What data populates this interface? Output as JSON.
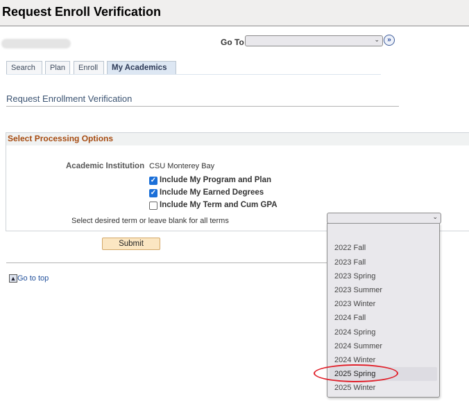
{
  "header": {
    "title": "Request Enroll Verification"
  },
  "goto": {
    "label": "Go To",
    "value": "",
    "go_icon": "double-chevron-right-icon"
  },
  "tabs": [
    {
      "label": "Search",
      "active": false
    },
    {
      "label": "Plan",
      "active": false
    },
    {
      "label": "Enroll",
      "active": false
    },
    {
      "label": "My Academics",
      "active": true
    }
  ],
  "page": {
    "subtitle": "Request Enrollment Verification"
  },
  "group": {
    "title": "Select Processing Options",
    "institution_label": "Academic Institution",
    "institution_value": "CSU Monterey Bay",
    "checkboxes": [
      {
        "label": "Include My Program and Plan",
        "checked": true
      },
      {
        "label": "Include My Earned Degrees",
        "checked": true
      },
      {
        "label": "Include My Term and Cum GPA",
        "checked": false
      }
    ],
    "term_label": "Select desired term or leave blank for all terms",
    "term_value": ""
  },
  "term_options": [
    "",
    "2022 Fall",
    "2023 Fall",
    "2023 Spring",
    "2023 Summer",
    "2023 Winter",
    "2024 Fall",
    "2024 Spring",
    "2024 Summer",
    "2024 Winter",
    "2025 Spring",
    "2025 Winter"
  ],
  "highlighted_option": "2025 Spring",
  "actions": {
    "submit": "Submit",
    "go_to_top": "Go to top"
  },
  "colors": {
    "section_title": "#a64b11",
    "annotation": "#e0202a",
    "link": "#1f4e9a"
  }
}
